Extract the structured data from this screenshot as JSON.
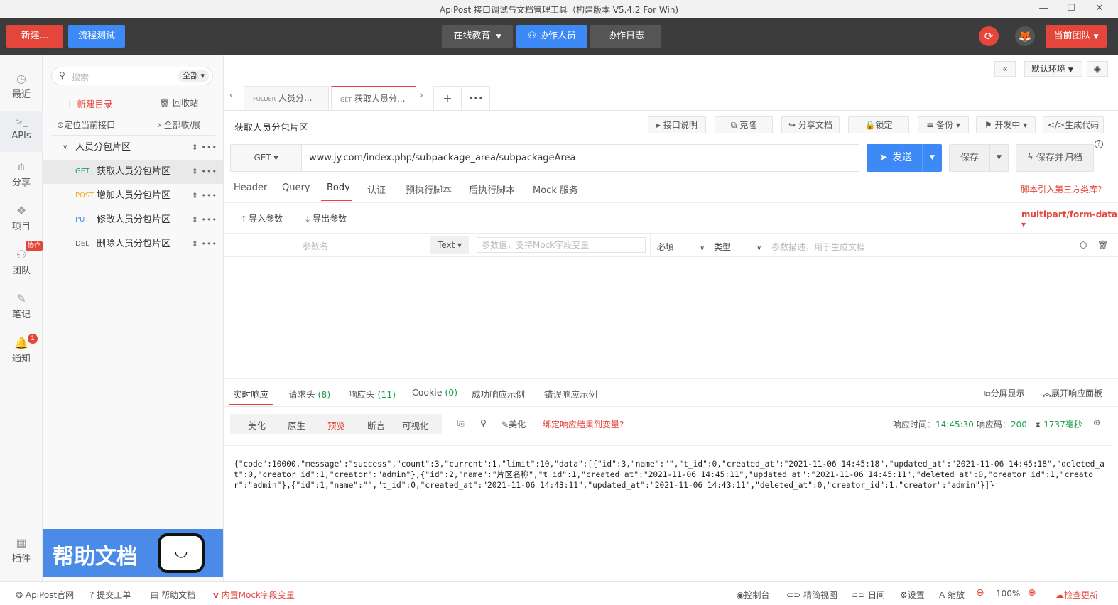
{
  "window": {
    "title": "ApiPost 接口调试与文档管理工具（构建版本 V5.4.2 For Win)",
    "minimize": "—",
    "maximize": "☐",
    "close": "✕"
  },
  "toolbar": {
    "new_label": "新建...",
    "flow_label": "流程测试",
    "edu_label": "在线教育",
    "collab_label": "协作人员",
    "log_label": "协作日志",
    "team_label": "当前团队"
  },
  "rail": {
    "items": [
      {
        "label": "最近",
        "icon": "clock-icon"
      },
      {
        "label": "APIs",
        "icon": "terminal-icon"
      },
      {
        "label": "分享",
        "icon": "share-icon"
      },
      {
        "label": "项目",
        "icon": "cubes-icon"
      },
      {
        "label": "团队",
        "icon": "sitemap-icon",
        "badge": "协作"
      },
      {
        "label": "笔记",
        "icon": "edit-icon"
      },
      {
        "label": "通知",
        "icon": "bell-icon",
        "badge": "1"
      },
      {
        "label": "插件",
        "icon": "grid-icon"
      }
    ]
  },
  "tree": {
    "search_placeholder": "搜索",
    "filter": "全部",
    "new_folder": "新建目录",
    "recycle": "回收站",
    "locate": "定位当前接口",
    "collapse": "全部收/展",
    "folder": "人员分包片区",
    "items": [
      {
        "method": "GET",
        "label": "获取人员分包片区"
      },
      {
        "method": "POST",
        "label": "增加人员分包片区"
      },
      {
        "method": "PUT",
        "label": "修改人员分包片区"
      },
      {
        "method": "DEL",
        "label": "删除人员分包片区"
      }
    ],
    "help_banner": "帮助文档"
  },
  "topright": {
    "env": "默认环境",
    "collapse_icon": "«"
  },
  "tabs": [
    {
      "kind": "FOLDER",
      "label": "人员分..."
    },
    {
      "kind": "GET",
      "label": "获取人员分..."
    }
  ],
  "api": {
    "title": "获取人员分包片区",
    "actions": {
      "doc": "接口说明",
      "clone": "克隆",
      "share": "分享文档",
      "lock": "锁定",
      "backup": "备份",
      "status": "开发中",
      "code": "生成代码"
    },
    "method": "GET",
    "url": "www.jy.com/index.php/subpackage_area/subpackageArea",
    "send": "发送",
    "save": "保存",
    "save_archive": "保存并归档"
  },
  "request_tabs": [
    "Header",
    "Query",
    "Body",
    "认证",
    "预执行脚本",
    "后执行脚本",
    "Mock 服务"
  ],
  "third_party_link": "脚本引入第三方类库?",
  "body": {
    "import": "导入参数",
    "export": "导出参数",
    "content_type": "multipart/form-data",
    "param_name_placeholder": "参数名",
    "type": "Text",
    "value_placeholder": "参数值，支持Mock字段变量",
    "required": "必填",
    "type_label": "类型",
    "desc_placeholder": "参数描述，用于生成文档"
  },
  "response_tabs": [
    {
      "label": "实时响应"
    },
    {
      "label": "请求头",
      "count": "(8)"
    },
    {
      "label": "响应头",
      "count": "(11)"
    },
    {
      "label": "Cookie",
      "count": "(0)"
    },
    {
      "label": "成功响应示例"
    },
    {
      "label": "错误响应示例"
    }
  ],
  "split": "分屏显示",
  "expand": "展开响应面板",
  "view_modes": [
    "美化",
    "原生",
    "预览",
    "断言",
    "可视化"
  ],
  "beautify": "美化",
  "bind_var": "绑定响应结果到变量?",
  "resp_meta": {
    "time_label": "响应时间：",
    "time": "14:45:30",
    "code_label": "响应码：",
    "code": "200",
    "duration": "1737毫秒"
  },
  "response_body": "{\"code\":10000,\"message\":\"success\",\"count\":3,\"current\":1,\"limit\":10,\"data\":[{\"id\":3,\"name\":\"\",\"t_id\":0,\"created_at\":\"2021-11-06 14:45:18\",\"updated_at\":\"2021-11-06 14:45:18\",\"deleted_at\":0,\"creator_id\":1,\"creator\":\"admin\"},{\"id\":2,\"name\":\"片区名称\",\"t_id\":1,\"created_at\":\"2021-11-06 14:45:11\",\"updated_at\":\"2021-11-06 14:45:11\",\"deleted_at\":0,\"creator_id\":1,\"creator\":\"admin\"},{\"id\":1,\"name\":\"\",\"t_id\":0,\"created_at\":\"2021-11-06 14:43:11\",\"updated_at\":\"2021-11-06 14:43:11\",\"deleted_at\":0,\"creator_id\":1,\"creator\":\"admin\"}]}",
  "status": {
    "site": "ApiPost官网",
    "ticket": "提交工单",
    "help": "帮助文档",
    "mock": "内置Mock字段变量",
    "console": "控制台",
    "compact": "精简视图",
    "day": "日间",
    "settings": "设置",
    "zoom": "缩放",
    "zoom_value": "100%",
    "update": "检查更新"
  },
  "colors": {
    "accent": "#3d8af7",
    "red": "#e5463b",
    "green": "#1e9c4d",
    "orange": "#f5a623"
  }
}
